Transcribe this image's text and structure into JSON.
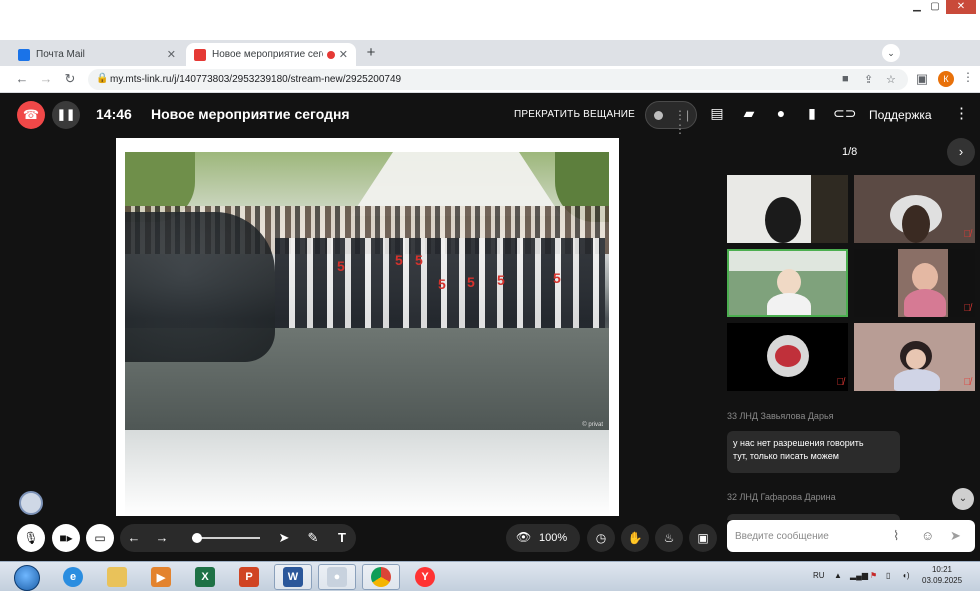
{
  "browser": {
    "tabs": [
      {
        "title": "Почта Mail",
        "favicon_color": "#1a73e8"
      },
      {
        "title": "Новое мероприятие сегодн",
        "favicon_color": "#e53935"
      }
    ],
    "new_tab": "+",
    "url": "my.mts-link.ru/j/140773803/2953239180/stream-new/2925200749",
    "profile_initial": "К"
  },
  "app": {
    "time": "14:46",
    "title": "Новое мероприятие сегодня",
    "stop_broadcast": "ПРЕКРАТИТЬ ВЕЩАНИЕ",
    "support": "Поддержка",
    "slide": {
      "labels": [
        "5",
        "5",
        "5",
        "5",
        "5",
        "5",
        "5"
      ],
      "watermark": "© privat"
    },
    "side": {
      "pager": "1/8",
      "participants_muted": [
        false,
        true,
        false,
        true,
        true,
        true
      ]
    },
    "chat": {
      "messages": [
        {
          "author": "33 ЛНД Завьялова Дарья",
          "text_line1": "у нас нет разрешения говорить",
          "text_line2": "тут, только писать можем"
        },
        {
          "author": "32 ЛНД Гафарова Дарина"
        }
      ],
      "input_placeholder": "Введите сообщение"
    },
    "zoom": "100%",
    "text_tool": "T"
  },
  "taskbar": {
    "lang": "RU",
    "time": "10:21",
    "date": "03.09.2025",
    "apps": [
      "X",
      "P",
      "W"
    ]
  }
}
